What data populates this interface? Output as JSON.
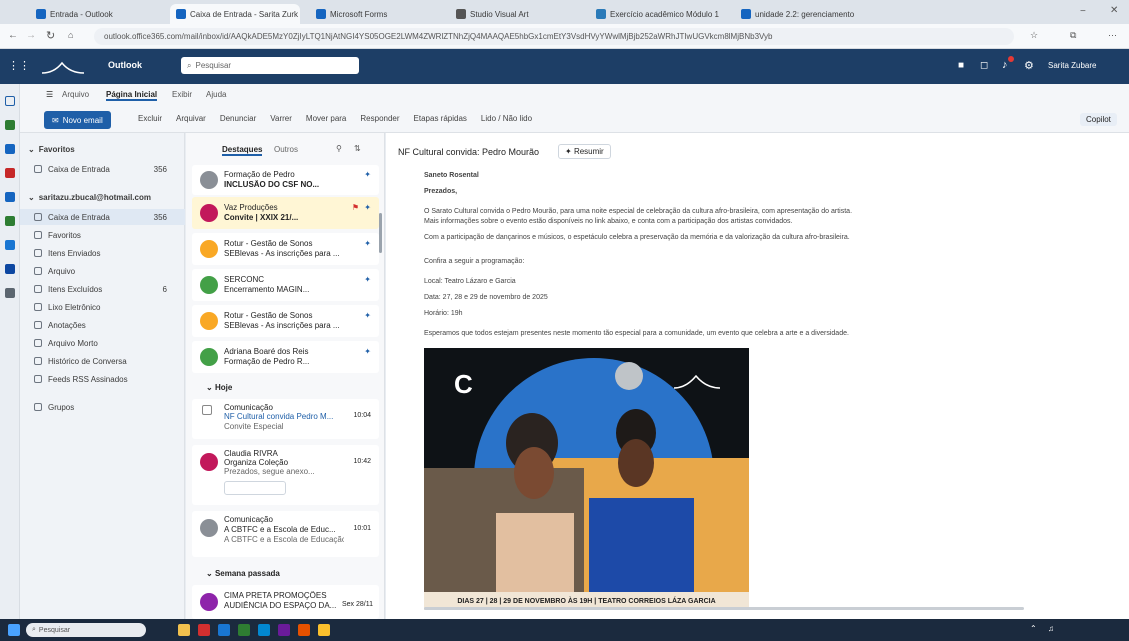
{
  "browser": {
    "tabs": [
      {
        "label": "Entrada - Outlook",
        "color": "#1565c0",
        "active": false
      },
      {
        "label": "Caixa de Entrada - Sarita Zurk",
        "color": "#1565c0",
        "active": true
      },
      {
        "label": "Microsoft Forms",
        "color": "#1565c0",
        "active": false
      },
      {
        "label": "Studio Visual Art",
        "color": "#555555",
        "active": false
      },
      {
        "label": "Exercício acadêmico Módulo 1",
        "color": "#2a7ab8",
        "active": false
      },
      {
        "label": "unidade 2.2: gerenciamento",
        "color": "#1565c0",
        "active": false
      }
    ],
    "url": "outlook.office365.com/mail/inbox/id/AAQkADE5MzY0ZjIyLTQ1NjAtNGI4YS05OGE2LWM4ZWRlZTNhZjQ4MAAQAE5hbGx1cmEtY3VsdHVyYWwlMjBjb252aWRhJTIwUGVkcm8lMjBNb3Vyb"
  },
  "outlook": {
    "app_name": "Outlook",
    "search_placeholder": "Pesquisar",
    "user_label": "Sarita Zubare"
  },
  "ribbon": {
    "tabs": [
      "Arquivo",
      "Página Inicial",
      "Exibir",
      "Ajuda"
    ],
    "active_tab": "Página Inicial",
    "new_mail": "Novo email",
    "commands": [
      "Excluir",
      "Arquivar",
      "Denunciar",
      "Varrer",
      "Mover para",
      "Responder",
      "Etapas rápidas",
      "Lido / Não lido"
    ],
    "copilot": "Copilot"
  },
  "folders": {
    "favorites_header": "Favoritos",
    "favorites": [
      {
        "label": "Caixa de Entrada",
        "count": "356"
      }
    ],
    "account_header": "saritazu.zbucal@hotmail.com",
    "items": [
      {
        "label": "Caixa de Entrada",
        "count": "356"
      },
      {
        "label": "Favoritos",
        "count": ""
      },
      {
        "label": "Itens Enviados",
        "count": ""
      },
      {
        "label": "Arquivo",
        "count": ""
      },
      {
        "label": "Itens Excluídos",
        "count": "6"
      },
      {
        "label": "Lixo Eletrônico",
        "count": ""
      },
      {
        "label": "Anotações",
        "count": ""
      },
      {
        "label": "Arquivo Morto",
        "count": ""
      },
      {
        "label": "Histórico de Conversa",
        "count": ""
      },
      {
        "label": "Feeds RSS Assinados",
        "count": ""
      }
    ],
    "groups": "Grupos"
  },
  "message_list": {
    "tabs": [
      "Destaques",
      "Outros"
    ],
    "section_today": "Hoje",
    "section_last_week": "Semana passada",
    "messages": [
      {
        "sender": "Formação de Pedro",
        "subject": "INCLUSÃO DO CSF NO...",
        "preview": "",
        "time": "",
        "color": "#8a8f96",
        "highlight": false
      },
      {
        "sender": "Vaz Produções",
        "subject": "Convite | XXIX 21/...",
        "preview": "",
        "time": "",
        "color": "#c2185b",
        "highlight": true
      },
      {
        "sender": "Rotur - Gestão de Sonos",
        "subject": "SEBlevas - As inscrições para ...",
        "preview": "",
        "time": "",
        "color": "#f9a825",
        "highlight": false
      },
      {
        "sender": "SERCONC",
        "subject": "Encerramento MAGIN...",
        "preview": "",
        "time": "",
        "color": "#43a047",
        "highlight": false
      },
      {
        "sender": "Rotur - Gestão de Sonos",
        "subject": "SEBlevas - As inscrições para ...",
        "preview": "",
        "time": "",
        "color": "#f9a825",
        "highlight": false
      },
      {
        "sender": "Adriana Boaré dos Reis",
        "subject": "Formação de Pedro R...",
        "preview": "",
        "time": "",
        "color": "#43a047",
        "highlight": false
      },
      {
        "sender": "Comunicação",
        "subject": "NF Cultural convida Pedro M...",
        "preview": "Convite Especial",
        "time": "10:04",
        "color": "#8a8f96",
        "highlight": false
      },
      {
        "sender": "Claudia RIVRA",
        "subject": "Organiza Coleção",
        "preview": "Prezados, segue anexo...",
        "time": "10:42",
        "color": "#c2185b",
        "highlight": false
      },
      {
        "sender": "Comunicação",
        "subject": "A CBTFC e a Escola de Educ...",
        "preview": "A CBTFC e a Escola de Educação P...",
        "time": "10:01",
        "color": "#8a8f96",
        "highlight": false
      },
      {
        "sender": "CIMA PRETA PROMOÇÕES",
        "subject": "AUDIÊNCIA DO ESPAÇO DA...",
        "preview": "",
        "time": "Sex 28/11",
        "color": "#8e24aa",
        "highlight": false
      }
    ]
  },
  "reading": {
    "subject": "NF Cultural convida: Pedro Mourão",
    "summary_button": "Resumir",
    "sender": "Saneto Rosental",
    "greeting": "Prezados,",
    "lines": [
      "O Sarato Cultural convida o Pedro Mourão, para uma noite especial de celebração da cultura afro-brasileira, com apresentação do artista.",
      "Mais informações sobre o evento estão disponíveis no link abaixo, e conta com a participação dos artistas convidados.",
      "Com a participação de dançarinos e músicos, o espetáculo celebra a preservação da memória e da valorização da cultura afro-brasileira.",
      "Confira a seguir a programação:",
      "Local: Teatro Lázaro e Garcia",
      "Data: 27, 28 e 29 de novembro de 2025",
      "Horário: 19h",
      "Esperamos que todos estejam presentes neste momento tão especial para a comunidade, um evento que celebra a arte e a diversidade."
    ],
    "poster_footer": "DIAS 27 | 28 | 29 DE NOVEMBRO ÀS 19H | TEATRO CORREIOS LÁZA GARCIA"
  },
  "taskbar": {
    "search_placeholder": "Pesquisar"
  },
  "colors": {
    "outlook_blue": "#1d3e66",
    "accent": "#1f5fa8",
    "highlight": "#fff6d5"
  }
}
